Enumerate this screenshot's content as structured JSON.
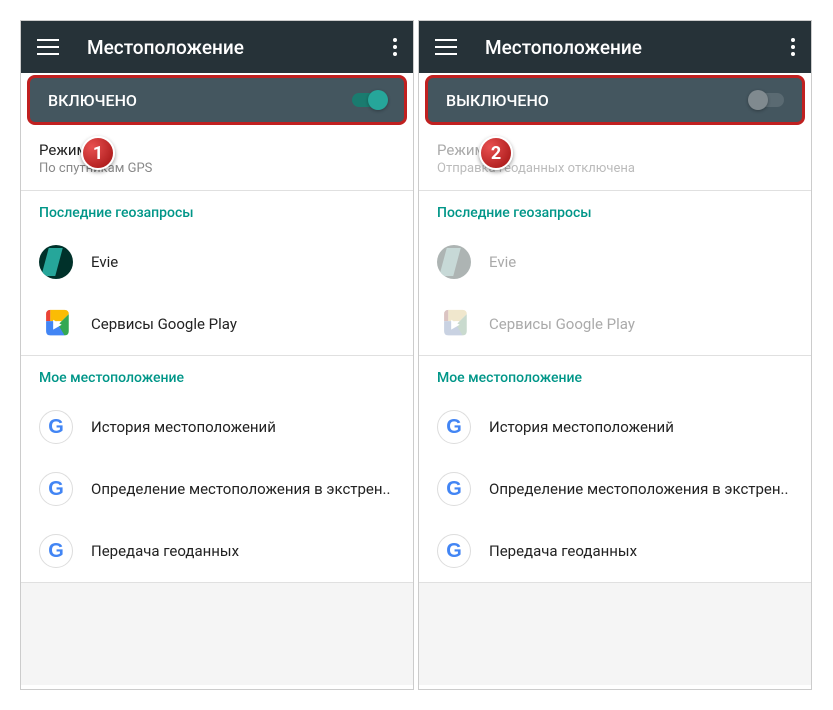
{
  "screens": [
    {
      "badge": "1",
      "title": "Местоположение",
      "toggle": {
        "label": "ВКЛЮЧЕНО",
        "on": true
      },
      "mode": {
        "title": "Режим",
        "sub": "По спутникам GPS",
        "disabled": false
      },
      "requests_header": "Последние геозапросы",
      "apps": [
        {
          "name": "Evie",
          "icon": "evie",
          "dim": false
        },
        {
          "name": "Сервисы Google Play",
          "icon": "play",
          "dim": false
        }
      ],
      "myloc_header": "Мое местоположение",
      "services": [
        {
          "name": "История местоположений"
        },
        {
          "name": "Определение местоположения в экстрен.."
        },
        {
          "name": "Передача геоданных"
        }
      ]
    },
    {
      "badge": "2",
      "title": "Местоположение",
      "toggle": {
        "label": "ВЫКЛЮЧЕНО",
        "on": false
      },
      "mode": {
        "title": "Режим",
        "sub": "Отправка геоданных отключена",
        "disabled": true
      },
      "requests_header": "Последние геозапросы",
      "apps": [
        {
          "name": "Evie",
          "icon": "evie",
          "dim": true
        },
        {
          "name": "Сервисы Google Play",
          "icon": "play",
          "dim": true
        }
      ],
      "myloc_header": "Мое местоположение",
      "services": [
        {
          "name": "История местоположений"
        },
        {
          "name": "Определение местоположения в экстрен.."
        },
        {
          "name": "Передача геоданных"
        }
      ]
    }
  ]
}
